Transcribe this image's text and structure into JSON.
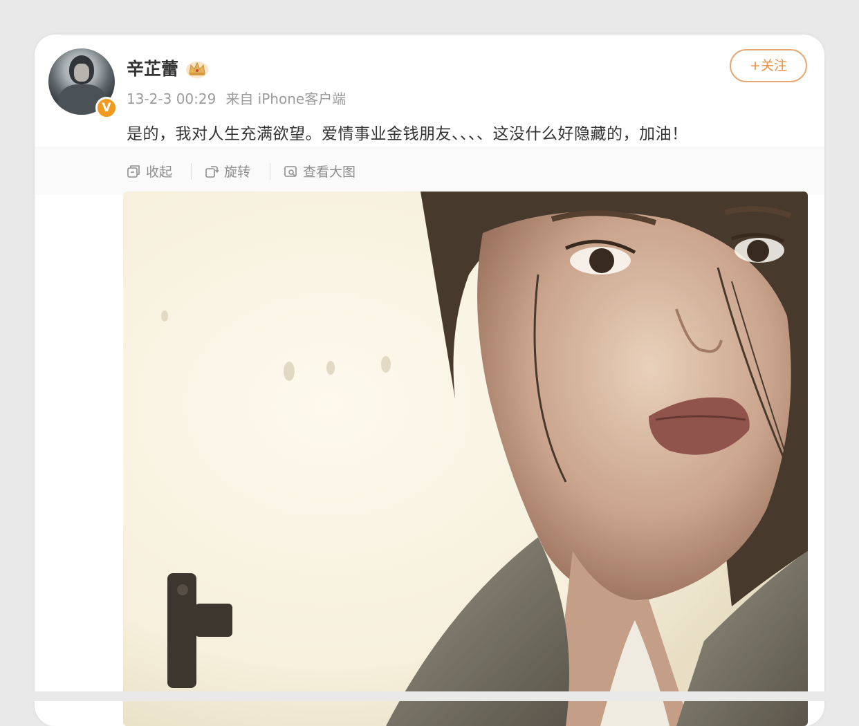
{
  "post": {
    "author": "辛芷蕾",
    "time": "13-2-3 00:29",
    "source": "来自 iPhone客户端",
    "follow_label": "+关注",
    "text": "是的，我对人生充满欲望。爱情事业金钱朋友、、、、这没什么好隐藏的，加油！",
    "verified_mark": "V"
  },
  "toolbar": {
    "collapse_label": "收起",
    "rotate_label": "旋转",
    "view_large_label": "查看大图"
  },
  "icons": [
    "avatar",
    "verified-icon",
    "crown-icon",
    "collapse-icon",
    "rotate-icon",
    "view-large-icon"
  ],
  "colors": {
    "accent": "#e98d3e",
    "verified": "#f29a1f",
    "text": "#333333",
    "muted": "#9b9b9b"
  }
}
